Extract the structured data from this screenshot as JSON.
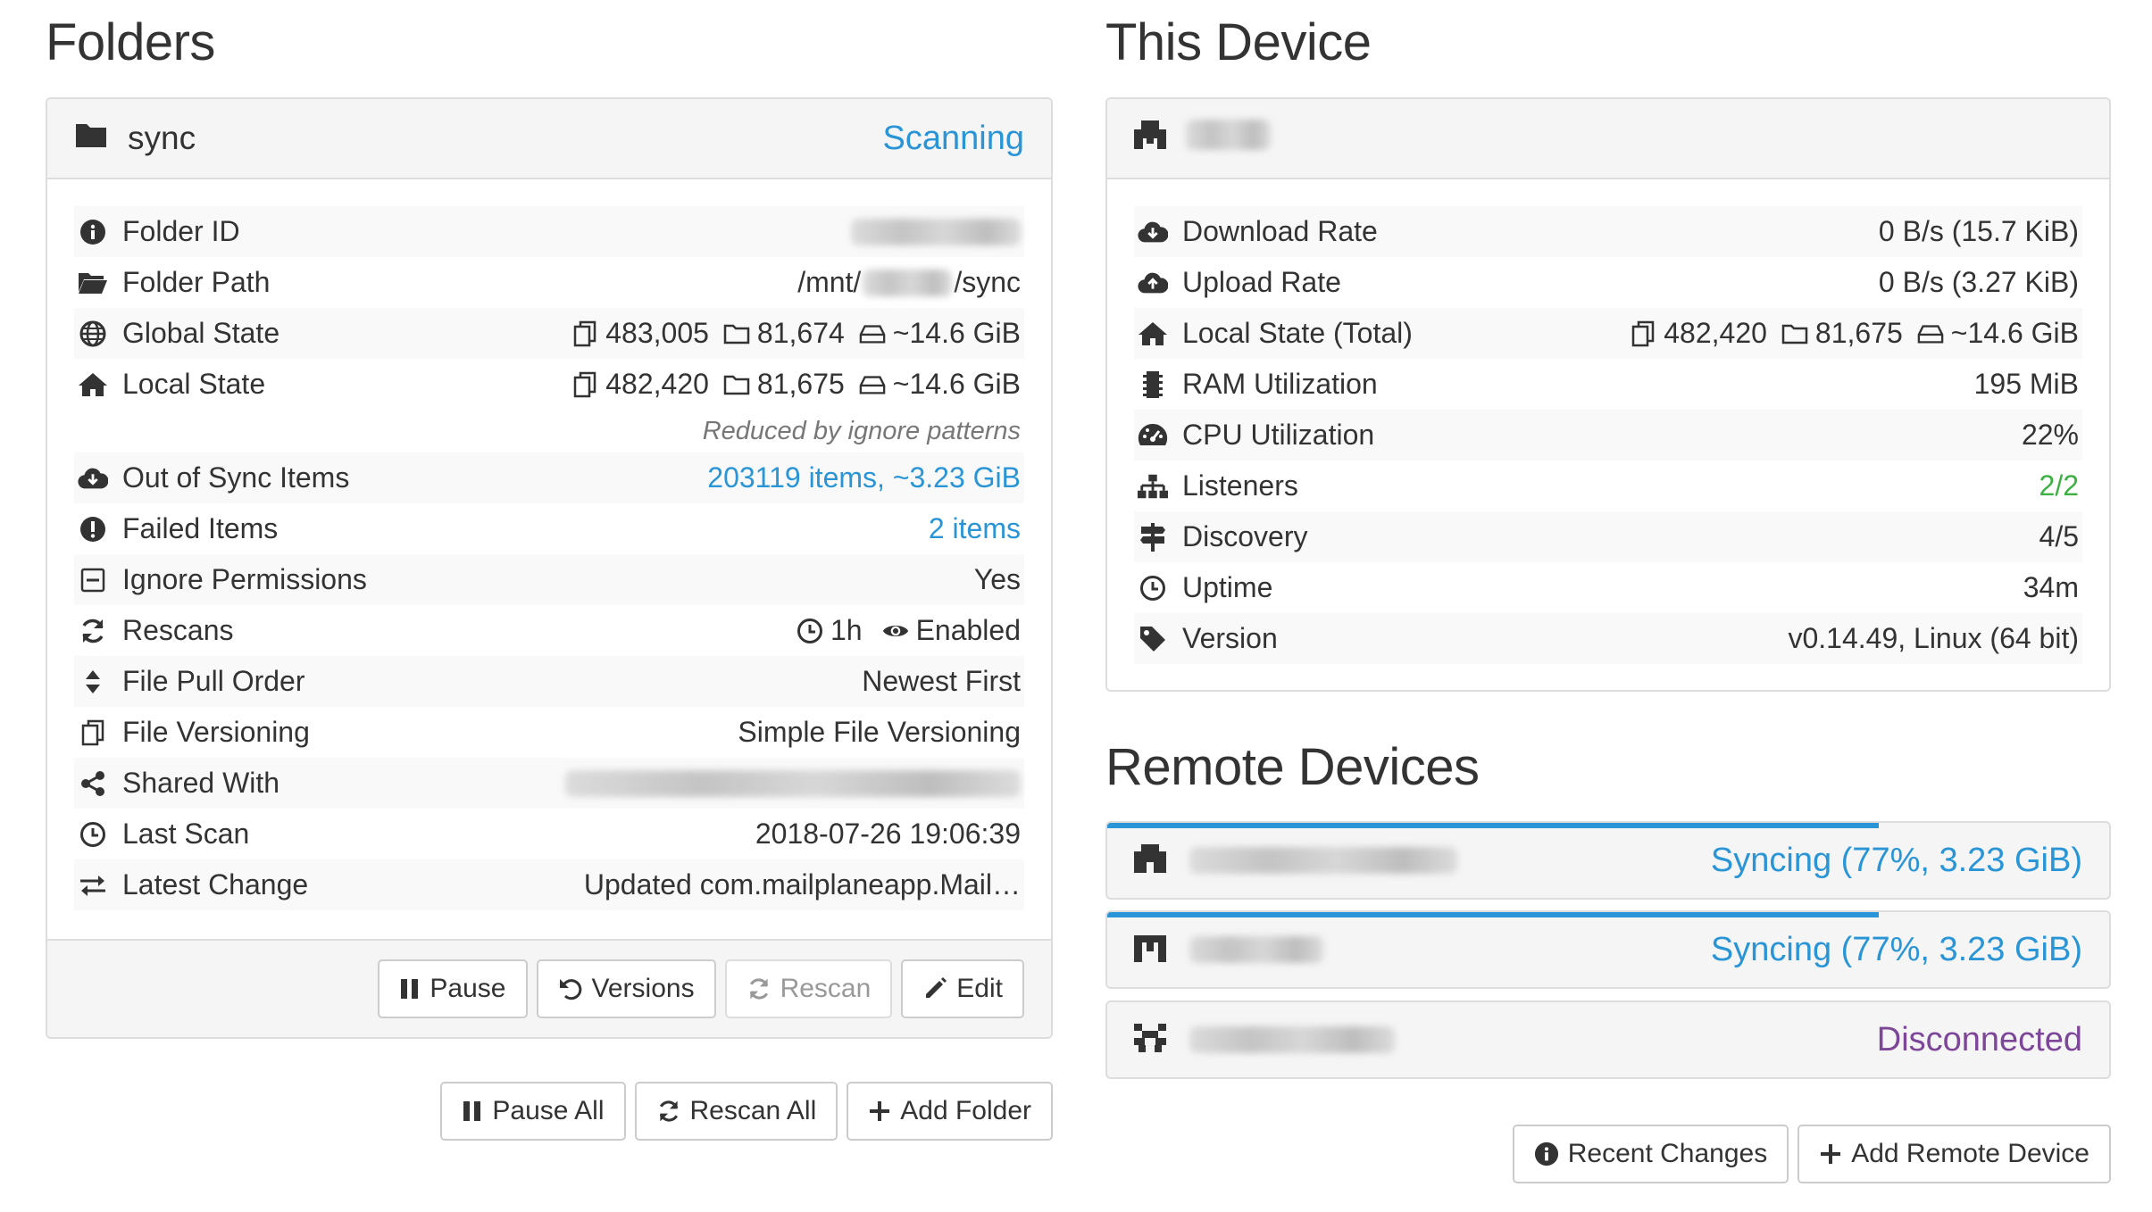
{
  "folders": {
    "title": "Folders",
    "folder": {
      "name": "sync",
      "status": "Scanning",
      "rows": [
        {
          "icon": "info-icon",
          "label": "Folder ID",
          "value": ""
        },
        {
          "icon": "folder-open-icon",
          "label": "Folder Path",
          "value_prefix": "/mnt/",
          "value_suffix": "/sync"
        },
        {
          "icon": "globe-icon",
          "label": "Global State",
          "files": "483,005",
          "dirs": "81,674",
          "size": "~14.6 GiB"
        },
        {
          "icon": "home-icon",
          "label": "Local State",
          "files": "482,420",
          "dirs": "81,675",
          "size": "~14.6 GiB"
        },
        {
          "icon": "cloud-download-icon",
          "label": "Out of Sync Items",
          "value": "203119 items, ~3.23 GiB"
        },
        {
          "icon": "exclamation-icon",
          "label": "Failed Items",
          "value": "2 items"
        },
        {
          "icon": "minus-square-icon",
          "label": "Ignore Permissions",
          "value": "Yes"
        },
        {
          "icon": "refresh-icon",
          "label": "Rescans",
          "interval": "1h",
          "watch": "Enabled"
        },
        {
          "icon": "sort-icon",
          "label": "File Pull Order",
          "value": "Newest First"
        },
        {
          "icon": "copy-icon",
          "label": "File Versioning",
          "value": "Simple File Versioning"
        },
        {
          "icon": "share-icon",
          "label": "Shared With",
          "value": ""
        },
        {
          "icon": "clock-icon",
          "label": "Last Scan",
          "value": "2018-07-26 19:06:39"
        },
        {
          "icon": "exchange-icon",
          "label": "Latest Change",
          "value": "Updated com.mailplaneapp.Mail…"
        }
      ],
      "ignore_note": "Reduced by ignore patterns",
      "buttons": {
        "pause": "Pause",
        "versions": "Versions",
        "rescan": "Rescan",
        "edit": "Edit"
      }
    },
    "buttons": {
      "pause_all": "Pause All",
      "rescan_all": "Rescan All",
      "add_folder": "Add Folder"
    }
  },
  "this_device": {
    "title": "This Device",
    "name": "",
    "rows": [
      {
        "icon": "cloud-download-icon",
        "label": "Download Rate",
        "value": "0 B/s (15.7 KiB)"
      },
      {
        "icon": "cloud-upload-icon",
        "label": "Upload Rate",
        "value": "0 B/s (3.27 KiB)"
      },
      {
        "icon": "home-icon",
        "label": "Local State (Total)",
        "files": "482,420",
        "dirs": "81,675",
        "size": "~14.6 GiB"
      },
      {
        "icon": "memory-icon",
        "label": "RAM Utilization",
        "value": "195 MiB"
      },
      {
        "icon": "dashboard-icon",
        "label": "CPU Utilization",
        "value": "22%"
      },
      {
        "icon": "sitemap-icon",
        "label": "Listeners",
        "value": "2/2"
      },
      {
        "icon": "signpost-icon",
        "label": "Discovery",
        "value": "4/5"
      },
      {
        "icon": "clock-icon",
        "label": "Uptime",
        "value": "34m"
      },
      {
        "icon": "tag-icon",
        "label": "Version",
        "value": "v0.14.49, Linux (64 bit)"
      }
    ]
  },
  "remote_devices": {
    "title": "Remote Devices",
    "devices": [
      {
        "name": "",
        "status": "Syncing (77%, 3.23 GiB)",
        "progress": 0.77
      },
      {
        "name": "",
        "status": "Syncing (77%, 3.23 GiB)",
        "progress": 0.77
      },
      {
        "name": "",
        "status": "Disconnected",
        "progress": 0
      }
    ],
    "buttons": {
      "recent_changes": "Recent Changes",
      "add_remote_device": "Add Remote Device"
    }
  },
  "colors": {
    "link": "#2a95d6",
    "green": "#3cb043",
    "purple": "#7d4698"
  }
}
